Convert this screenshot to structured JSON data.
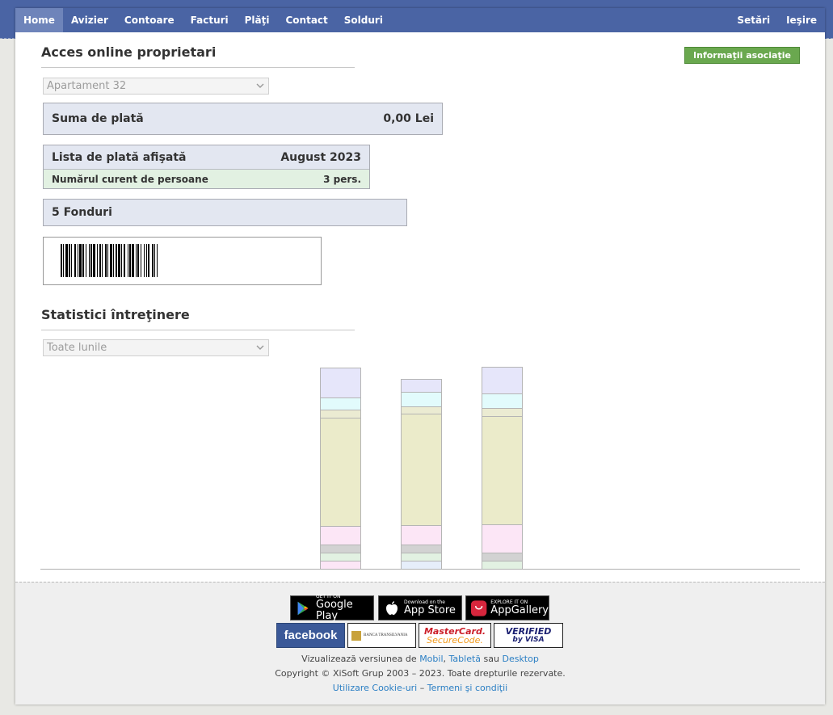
{
  "nav": {
    "left": [
      "Home",
      "Avizier",
      "Contoare",
      "Facturi",
      "Plăţi",
      "Contact",
      "Solduri"
    ],
    "right": [
      "Setări",
      "Ieşire"
    ]
  },
  "header": {
    "title": "Acces online proprietari",
    "info_button": "Informaţii asociaţie"
  },
  "apartment_select": {
    "value": "Apartament 32"
  },
  "payment": {
    "label": "Suma de plată",
    "amount": "0,00 Lei"
  },
  "list": {
    "label": "Lista de plată afişată",
    "month": "August 2023",
    "persons_label": "Numărul curent de persoane",
    "persons_value": "3 pers."
  },
  "funds": {
    "label": "5 Fonduri"
  },
  "stats": {
    "title": "Statistici întreţinere",
    "period_select": "Toate lunile"
  },
  "chart_data": {
    "type": "bar",
    "stacked": true,
    "categories": [
      "",
      "",
      ""
    ],
    "segment_colors": [
      "#fce6f6",
      "#e6eefa",
      "#e2f1e2",
      "#d2d2d2",
      "#fce6f6",
      "#ebebca",
      "#ebebd2",
      "#e2fbfc",
      "#e6e6fa"
    ],
    "series": [
      {
        "values": [
          10,
          0,
          10,
          10,
          23,
          134,
          10,
          15,
          37
        ]
      },
      {
        "values": [
          0,
          10,
          10,
          10,
          24,
          138,
          9,
          18,
          16
        ]
      },
      {
        "values": [
          0,
          0,
          10,
          10,
          35,
          134,
          10,
          18,
          33
        ]
      }
    ]
  },
  "footer": {
    "badges": {
      "google": {
        "small": "GET IT ON",
        "big": "Google Play"
      },
      "apple": {
        "small": "Download on the",
        "big": "App Store"
      },
      "huawei": {
        "small": "EXPLORE IT ON",
        "big": "AppGallery"
      },
      "facebook": "facebook",
      "bank": "BANCA TRANSILVANIA",
      "mastercard_1": "MasterCard.",
      "mastercard_2": "SecureCode.",
      "visa_1": "VERIFIED",
      "visa_2": "by VISA"
    },
    "version_prefix": "Vizualizează versiunea de",
    "mobile": "Mobil",
    "comma": ",",
    "tablet": "Tabletă",
    "or": "sau",
    "desktop": "Desktop",
    "copyright": "Copyright © XiSoft Grup 2003 – 2023. Toate drepturile rezervate.",
    "cookies": "Utilizare Cookie-uri",
    "dash": "–",
    "terms": "Termeni şi condiţii"
  }
}
